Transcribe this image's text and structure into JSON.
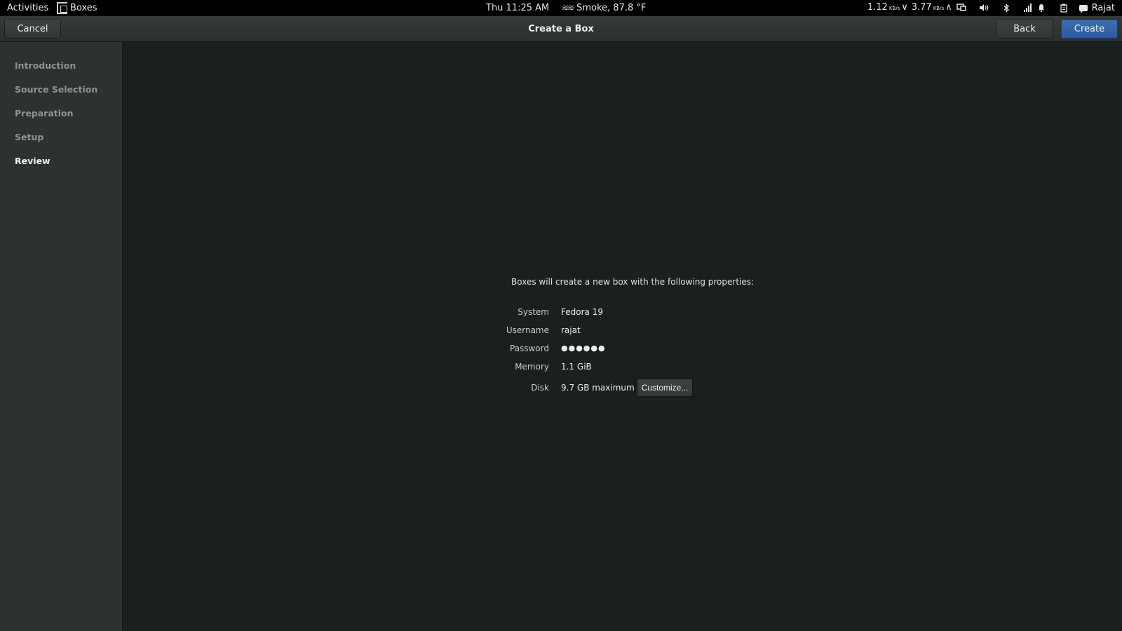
{
  "topbar": {
    "activities": "Activities",
    "app_name": "Boxes",
    "clock": "Thu 11:25 AM",
    "weather": "Smoke, 87.8 °F",
    "net_down": "1.12",
    "net_down_unit": "KB/s",
    "net_up": "3.77",
    "net_up_unit": "KB/s",
    "user": "Rajat"
  },
  "header": {
    "title": "Create a Box",
    "cancel_label": "Cancel",
    "back_label": "Back",
    "create_label": "Create"
  },
  "sidebar": {
    "steps": [
      "Introduction",
      "Source Selection",
      "Preparation",
      "Setup",
      "Review"
    ],
    "active_step": "Review"
  },
  "review": {
    "intro": "Boxes will create a new box with the following properties:",
    "properties": [
      {
        "label": "System",
        "value": "Fedora 19"
      },
      {
        "label": "Username",
        "value": "rajat"
      },
      {
        "label": "Password",
        "value": "●●●●●●"
      },
      {
        "label": "Memory",
        "value": "1.1 GiB"
      },
      {
        "label": "Disk",
        "value": "9.7 GB maximum"
      }
    ],
    "customize_label": "Customize..."
  },
  "colors": {
    "accent": "#2f62a7",
    "sidebar_bg": "#2c3232",
    "main_bg": "#1c1f1f",
    "topbar_bg": "#000000"
  }
}
